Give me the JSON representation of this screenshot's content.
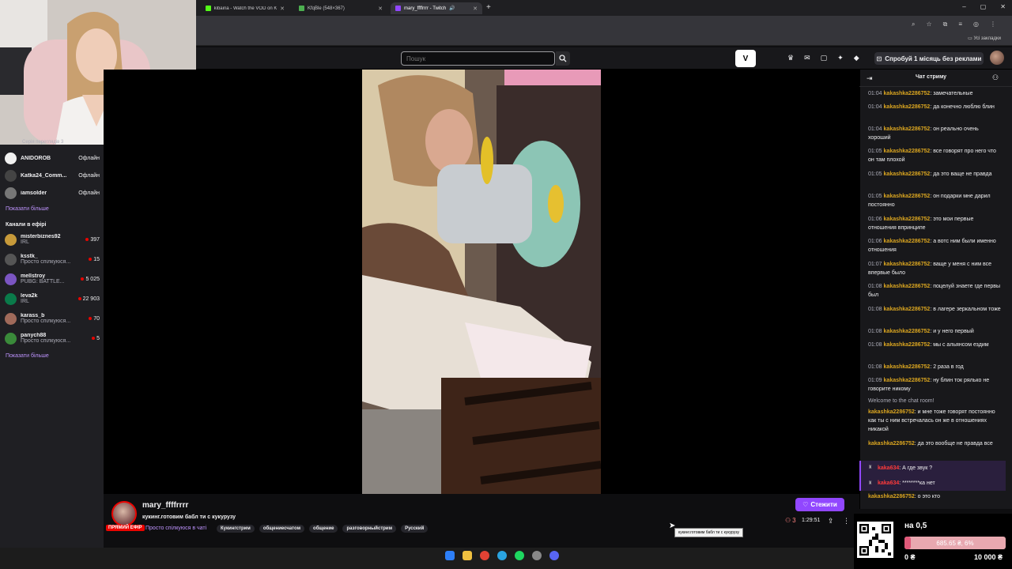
{
  "browser": {
    "tabs": [
      {
        "title": "kibaina - Watch the VOD on Ki",
        "favicon_color": "#53fc18"
      },
      {
        "title": "KfqBle (548×367)",
        "favicon_color": "#4caf50"
      },
      {
        "title": "mary_ffffrrrr - Twitch",
        "favicon_color": "#9147ff"
      }
    ],
    "new_tab": "+",
    "bookmarks_all": "Усі закладки"
  },
  "nav": {
    "search_placeholder": "Пошук",
    "turbo_logo": "V",
    "prime_label": "Спробуй 1 місяць без реклами"
  },
  "sidebar": {
    "truncated_top": "Серія переглядів 3",
    "offline_channels": [
      {
        "name": "ANIDOROB",
        "status": "Офлайн",
        "color": "#f0f0f0"
      },
      {
        "name": "Katka24_Comm...",
        "status": "Офлайн",
        "color": "#444444"
      },
      {
        "name": "iamsolder",
        "status": "Офлайн",
        "color": "#777777"
      }
    ],
    "show_more_1": "Показати більше",
    "live_heading": "Канали в ефірі",
    "live_channels": [
      {
        "name": "misterbiznes92",
        "category": "IRL",
        "viewers": "397",
        "color": "#c79a3a"
      },
      {
        "name": "ksstk_",
        "category": "Просто спілкуюся...",
        "viewers": "15",
        "color": "#555555"
      },
      {
        "name": "mellstroy",
        "category": "PUBG: BATTLE...",
        "viewers": "5 025",
        "color": "#7b55c2"
      },
      {
        "name": "leva2k",
        "category": "IRL",
        "viewers": "22 903",
        "color": "#0a7a4a"
      },
      {
        "name": "karass_b",
        "category": "Просто спілкуюся...",
        "viewers": "70",
        "color": "#a06a5a"
      },
      {
        "name": "panych88",
        "category": "Просто спілкуюся...",
        "viewers": "5",
        "color": "#3a8a3a"
      }
    ],
    "show_more_2": "Показати більше"
  },
  "stream": {
    "channel": "mary_ffffrrrr",
    "title": "кукинг.готовим бабл ти с кукурузу",
    "live_badge": "ПРЯМИЙ ЕФІР",
    "category": "Просто спілкуюся в чаті",
    "tags": [
      "Кукингстрим",
      "общениесчатом",
      "общение",
      "разговорныйстрим",
      "Русский"
    ],
    "follow_label": "Стежити",
    "viewers": "3",
    "uptime": "1:29:51",
    "tooltip": "кукинг.готовим бабл ти с кукурузу"
  },
  "chat": {
    "title": "Чат стриму",
    "messages": [
      {
        "ts": "01:04",
        "user": "kakashka2286752",
        "text": ": замечательные"
      },
      {
        "ts": "01:04",
        "user": "kakashka2286752",
        "text": ": да конечно люблю блин"
      },
      {
        "ts": "01:04",
        "user": "kakashka2286752",
        "text": ": он реально очень хороший"
      },
      {
        "ts": "01:05",
        "user": "kakashka2286752",
        "text": ": все говорят про него что он там плохой"
      },
      {
        "ts": "01:05",
        "user": "kakashka2286752",
        "text": ": да это ваще не правда"
      },
      {
        "ts": "01:05",
        "user": "kakashka2286752",
        "text": ": он подарки мне дарил постоянно"
      },
      {
        "ts": "01:06",
        "user": "kakashka2286752",
        "text": ": это мои первые отношения впринципе"
      },
      {
        "ts": "01:06",
        "user": "kakashka2286752",
        "text": ": а вотс ним были именно отношения"
      },
      {
        "ts": "01:07",
        "user": "kakashka2286752",
        "text": ": ваще у меня с ним все впервые было"
      },
      {
        "ts": "01:08",
        "user": "kakashka2286752",
        "text": ": поцелуй знаете где первы был"
      },
      {
        "ts": "01:08",
        "user": "kakashka2286752",
        "text": ": в лагере зеркальном тоже"
      },
      {
        "ts": "01:08",
        "user": "kakashka2286752",
        "text": ": и у него первый"
      },
      {
        "ts": "01:08",
        "user": "kakashka2286752",
        "text": ": мы с альянсом ездим"
      },
      {
        "ts": "01:08",
        "user": "kakashka2286752",
        "text": ": 2 раза в год"
      },
      {
        "ts": "01:09",
        "user": "kakashka2286752",
        "text": ": ну блин ток рялько не говорите никому"
      }
    ],
    "welcome": "Welcome to the chat room!",
    "recent": [
      {
        "user": "kakashka2286752",
        "text": ": и мне тоже говорят постоянно как ты с ним встречалась он же в отношениях никакой"
      },
      {
        "user": "kakashka2286752",
        "text": ": да это вообще не правда все"
      }
    ],
    "highlighted": [
      {
        "user": "kaka634",
        "text": ": А где звук ?"
      },
      {
        "user": "kaka634",
        "text": ": ********ка нет"
      }
    ],
    "last": {
      "user": "kakashka2286752",
      "text": ": о это кто"
    }
  },
  "goal": {
    "title": "на 0,5",
    "progress_label": "685.65 ₴, 6%",
    "progress": 0.06,
    "min": "0 ₴",
    "max": "10 000 ₴"
  },
  "colors": {
    "twitch_purple": "#9147ff",
    "live_red": "#eb0400",
    "chat_user": "#daa520"
  }
}
